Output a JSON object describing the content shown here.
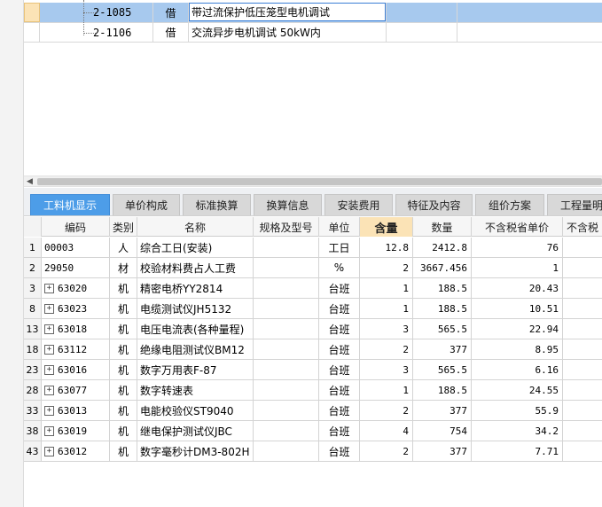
{
  "top_rows": [
    {
      "code": "2-1085",
      "type": "借",
      "name": "带过流保护低压笼型电机调试",
      "selected": true
    },
    {
      "code": "2-1106",
      "type": "借",
      "name": "交流异步电机调试 50kW内",
      "selected": false
    }
  ],
  "tabs": [
    "工料机显示",
    "单价构成",
    "标准换算",
    "换算信息",
    "安装费用",
    "特征及内容",
    "组价方案",
    "工程量明"
  ],
  "active_tab": "工料机显示",
  "columns": [
    "编码",
    "类别",
    "名称",
    "规格及型号",
    "单位",
    "含量",
    "数量",
    "不含税省单价",
    "不含税"
  ],
  "rows": [
    {
      "idx": "1",
      "expand": false,
      "code": "00003",
      "cat": "人",
      "name": "综合工日(安装)",
      "spec": "",
      "unit": "工日",
      "qty_rate": "12.8",
      "qty": "2412.8",
      "price": "76"
    },
    {
      "idx": "2",
      "expand": false,
      "code": "29050",
      "cat": "材",
      "name": "校验材料费占人工费",
      "spec": "",
      "unit": "%",
      "qty_rate": "2",
      "qty": "3667.456",
      "price": "1"
    },
    {
      "idx": "3",
      "expand": true,
      "code": "63020",
      "cat": "机",
      "name": "精密电桥YY2814",
      "spec": "",
      "unit": "台班",
      "qty_rate": "1",
      "qty": "188.5",
      "price": "20.43"
    },
    {
      "idx": "8",
      "expand": true,
      "code": "63023",
      "cat": "机",
      "name": "电缆测试仪JH5132",
      "spec": "",
      "unit": "台班",
      "qty_rate": "1",
      "qty": "188.5",
      "price": "10.51"
    },
    {
      "idx": "13",
      "expand": true,
      "code": "63018",
      "cat": "机",
      "name": "电压电流表(各种量程)",
      "spec": "",
      "unit": "台班",
      "qty_rate": "3",
      "qty": "565.5",
      "price": "22.94"
    },
    {
      "idx": "18",
      "expand": true,
      "code": "63112",
      "cat": "机",
      "name": "绝缘电阻测试仪BM12",
      "spec": "",
      "unit": "台班",
      "qty_rate": "2",
      "qty": "377",
      "price": "8.95"
    },
    {
      "idx": "23",
      "expand": true,
      "code": "63016",
      "cat": "机",
      "name": "数字万用表F-87",
      "spec": "",
      "unit": "台班",
      "qty_rate": "3",
      "qty": "565.5",
      "price": "6.16"
    },
    {
      "idx": "28",
      "expand": true,
      "code": "63077",
      "cat": "机",
      "name": "数字转速表",
      "spec": "",
      "unit": "台班",
      "qty_rate": "1",
      "qty": "188.5",
      "price": "24.55"
    },
    {
      "idx": "33",
      "expand": true,
      "code": "63013",
      "cat": "机",
      "name": "电能校验仪ST9040",
      "spec": "",
      "unit": "台班",
      "qty_rate": "2",
      "qty": "377",
      "price": "55.9"
    },
    {
      "idx": "38",
      "expand": true,
      "code": "63019",
      "cat": "机",
      "name": "继电保护测试仪JBC",
      "spec": "",
      "unit": "台班",
      "qty_rate": "4",
      "qty": "754",
      "price": "34.2"
    },
    {
      "idx": "43",
      "expand": true,
      "code": "63012",
      "cat": "机",
      "name": "数字毫秒计DM3-802H",
      "spec": "",
      "unit": "台班",
      "qty_rate": "2",
      "qty": "377",
      "price": "7.71"
    }
  ],
  "colors": {
    "selected_row": "#a7c9ee",
    "active_tab": "#4d9de8",
    "highlight_header": "#fbe3b6"
  }
}
